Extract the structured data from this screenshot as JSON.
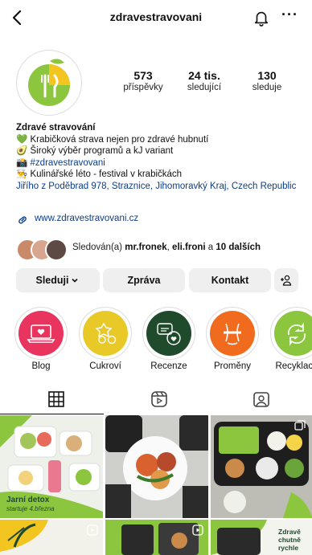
{
  "header": {
    "username": "zdravestravovani"
  },
  "stats": [
    {
      "value": "573",
      "label": "příspěvky"
    },
    {
      "value": "24 tis.",
      "label": "sledující"
    },
    {
      "value": "130",
      "label": "sleduje"
    }
  ],
  "bio": {
    "name": "Zdravé stravování",
    "lines": [
      "💚 Krabičková strava nejen pro zdravé hubnutí",
      "🥑 Široký výběr programů a kJ variant",
      "📸",
      "👨‍🍳 Kulinářské léto - festival v krabičkách"
    ],
    "hashtag": "#zdravestravovani",
    "address": "Jiřího z Poděbrad 978, Straznice, Jihomoravký Kraj, Czech Republic",
    "website": "www.zdravestravovani.cz"
  },
  "followed_by": {
    "prefix": "Sledován(a)",
    "user1": "mr.fronek",
    "sep": ",",
    "user2": "eli.froni",
    "and": "a",
    "others": "10 dalších"
  },
  "buttons": {
    "follow": "Sleduji",
    "message": "Zpráva",
    "contact": "Kontakt"
  },
  "highlights": [
    {
      "label": "Blog",
      "color": "#e8345f"
    },
    {
      "label": "Cukroví",
      "color": "#e8c928"
    },
    {
      "label": "Recenze",
      "color": "#1f4a2c"
    },
    {
      "label": "Proměny",
      "color": "#f06b1e"
    },
    {
      "label": "Recyklace",
      "color": "#8cc63f"
    }
  ],
  "grid": {
    "post1_text": "Jarní detox",
    "post1_sub": "startuje 4.března",
    "post6_text": "Zdravě chutně rychle"
  },
  "colors": {
    "brand_green": "#8cc63f",
    "brand_yellow": "#f2c521",
    "link_blue": "#0b3d8a"
  }
}
